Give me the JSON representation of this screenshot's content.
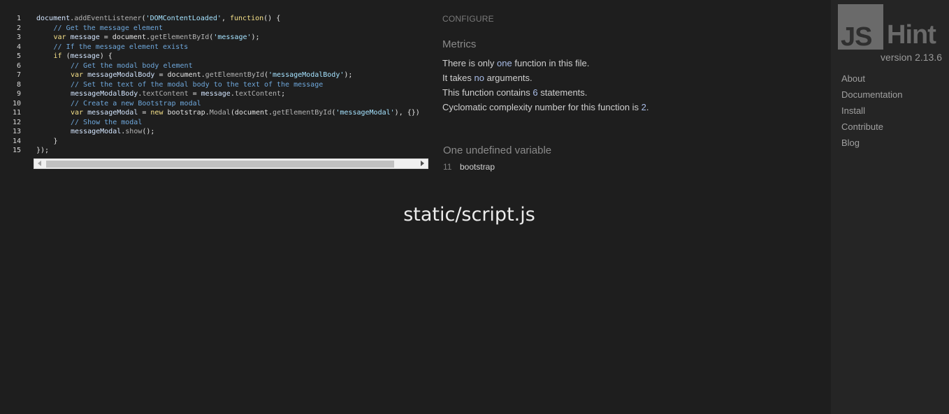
{
  "editor": {
    "lines": [
      {
        "n": "1",
        "indent": 0,
        "parts": [
          [
            "t-var",
            "document"
          ],
          [
            "",
            "."
          ],
          [
            "t-fn",
            "addEventListener"
          ],
          [
            "",
            "("
          ],
          [
            "t-str",
            "'DOMContentLoaded'"
          ],
          [
            "",
            ", "
          ],
          [
            "t-kw",
            "function"
          ],
          [
            "",
            "() {"
          ]
        ]
      },
      {
        "n": "2",
        "indent": 1,
        "parts": [
          [
            "t-cmt",
            "// Get the message element"
          ]
        ]
      },
      {
        "n": "3",
        "indent": 1,
        "parts": [
          [
            "t-kw",
            "var "
          ],
          [
            "t-var",
            "message"
          ],
          [
            "",
            " = document."
          ],
          [
            "t-fn",
            "getElementById"
          ],
          [
            "",
            "("
          ],
          [
            "t-str",
            "'message'"
          ],
          [
            "",
            ");"
          ]
        ]
      },
      {
        "n": "4",
        "indent": 1,
        "parts": [
          [
            "t-cmt",
            "// If the message element exists"
          ]
        ]
      },
      {
        "n": "5",
        "indent": 1,
        "parts": [
          [
            "t-kw",
            "if"
          ],
          [
            "",
            " ("
          ],
          [
            "t-var",
            "message"
          ],
          [
            "",
            ") {"
          ]
        ]
      },
      {
        "n": "6",
        "indent": 2,
        "parts": [
          [
            "t-cmt",
            "// Get the modal body element"
          ]
        ]
      },
      {
        "n": "7",
        "indent": 2,
        "parts": [
          [
            "t-kw",
            "var "
          ],
          [
            "t-var",
            "messageModalBody"
          ],
          [
            "",
            " = document."
          ],
          [
            "t-fn",
            "getElementById"
          ],
          [
            "",
            "("
          ],
          [
            "t-str",
            "'messageModalBody'"
          ],
          [
            "",
            ");"
          ]
        ]
      },
      {
        "n": "8",
        "indent": 2,
        "parts": [
          [
            "t-cmt",
            "// Set the text of the modal body to the text of the message"
          ]
        ]
      },
      {
        "n": "9",
        "indent": 2,
        "parts": [
          [
            "t-var",
            "messageModalBody"
          ],
          [
            "",
            "."
          ],
          [
            "t-fn",
            "textContent"
          ],
          [
            "",
            " = "
          ],
          [
            "t-var",
            "message"
          ],
          [
            "",
            "."
          ],
          [
            "t-fn",
            "textContent"
          ],
          [
            "",
            ";"
          ]
        ]
      },
      {
        "n": "10",
        "indent": 2,
        "parts": [
          [
            "t-cmt",
            "// Create a new Bootstrap modal"
          ]
        ]
      },
      {
        "n": "11",
        "indent": 2,
        "parts": [
          [
            "t-kw",
            "var "
          ],
          [
            "t-var",
            "messageModal"
          ],
          [
            "",
            " = "
          ],
          [
            "t-kw",
            "new "
          ],
          [
            "",
            "bootstrap."
          ],
          [
            "t-fn",
            "Modal"
          ],
          [
            "",
            "(document."
          ],
          [
            "t-fn",
            "getElementById"
          ],
          [
            "",
            "("
          ],
          [
            "t-str",
            "'messageModal'"
          ],
          [
            "",
            "), {})"
          ]
        ]
      },
      {
        "n": "12",
        "indent": 2,
        "parts": [
          [
            "t-cmt",
            "// Show the modal"
          ]
        ]
      },
      {
        "n": "13",
        "indent": 2,
        "parts": [
          [
            "t-var",
            "messageModal"
          ],
          [
            "",
            "."
          ],
          [
            "t-fn",
            "show"
          ],
          [
            "",
            "();"
          ]
        ]
      },
      {
        "n": "14",
        "indent": 1,
        "parts": [
          [
            "",
            "}"
          ]
        ]
      },
      {
        "n": "15",
        "indent": 0,
        "parts": [
          [
            "",
            "});"
          ]
        ]
      }
    ]
  },
  "report": {
    "configure_label": "CONFIGURE",
    "metrics_title": "Metrics",
    "metrics": [
      {
        "pre": "There is only ",
        "hl": "one",
        "post": " function in this file."
      },
      {
        "pre": "It takes ",
        "hl": "no",
        "post": " arguments."
      },
      {
        "pre": "This function contains ",
        "hl": "6",
        "post": " statements."
      },
      {
        "pre": "Cyclomatic complexity number for this function is ",
        "hl": "2",
        "post": "."
      }
    ],
    "undefined_title": "One undefined variable",
    "undefined": {
      "line": "11",
      "name": "bootstrap"
    }
  },
  "filename": "static/script.js",
  "sidebar": {
    "logo_left": "JS",
    "logo_right": "Hint",
    "version": "version 2.13.6",
    "nav": [
      "About",
      "Documentation",
      "Install",
      "Contribute",
      "Blog"
    ]
  }
}
